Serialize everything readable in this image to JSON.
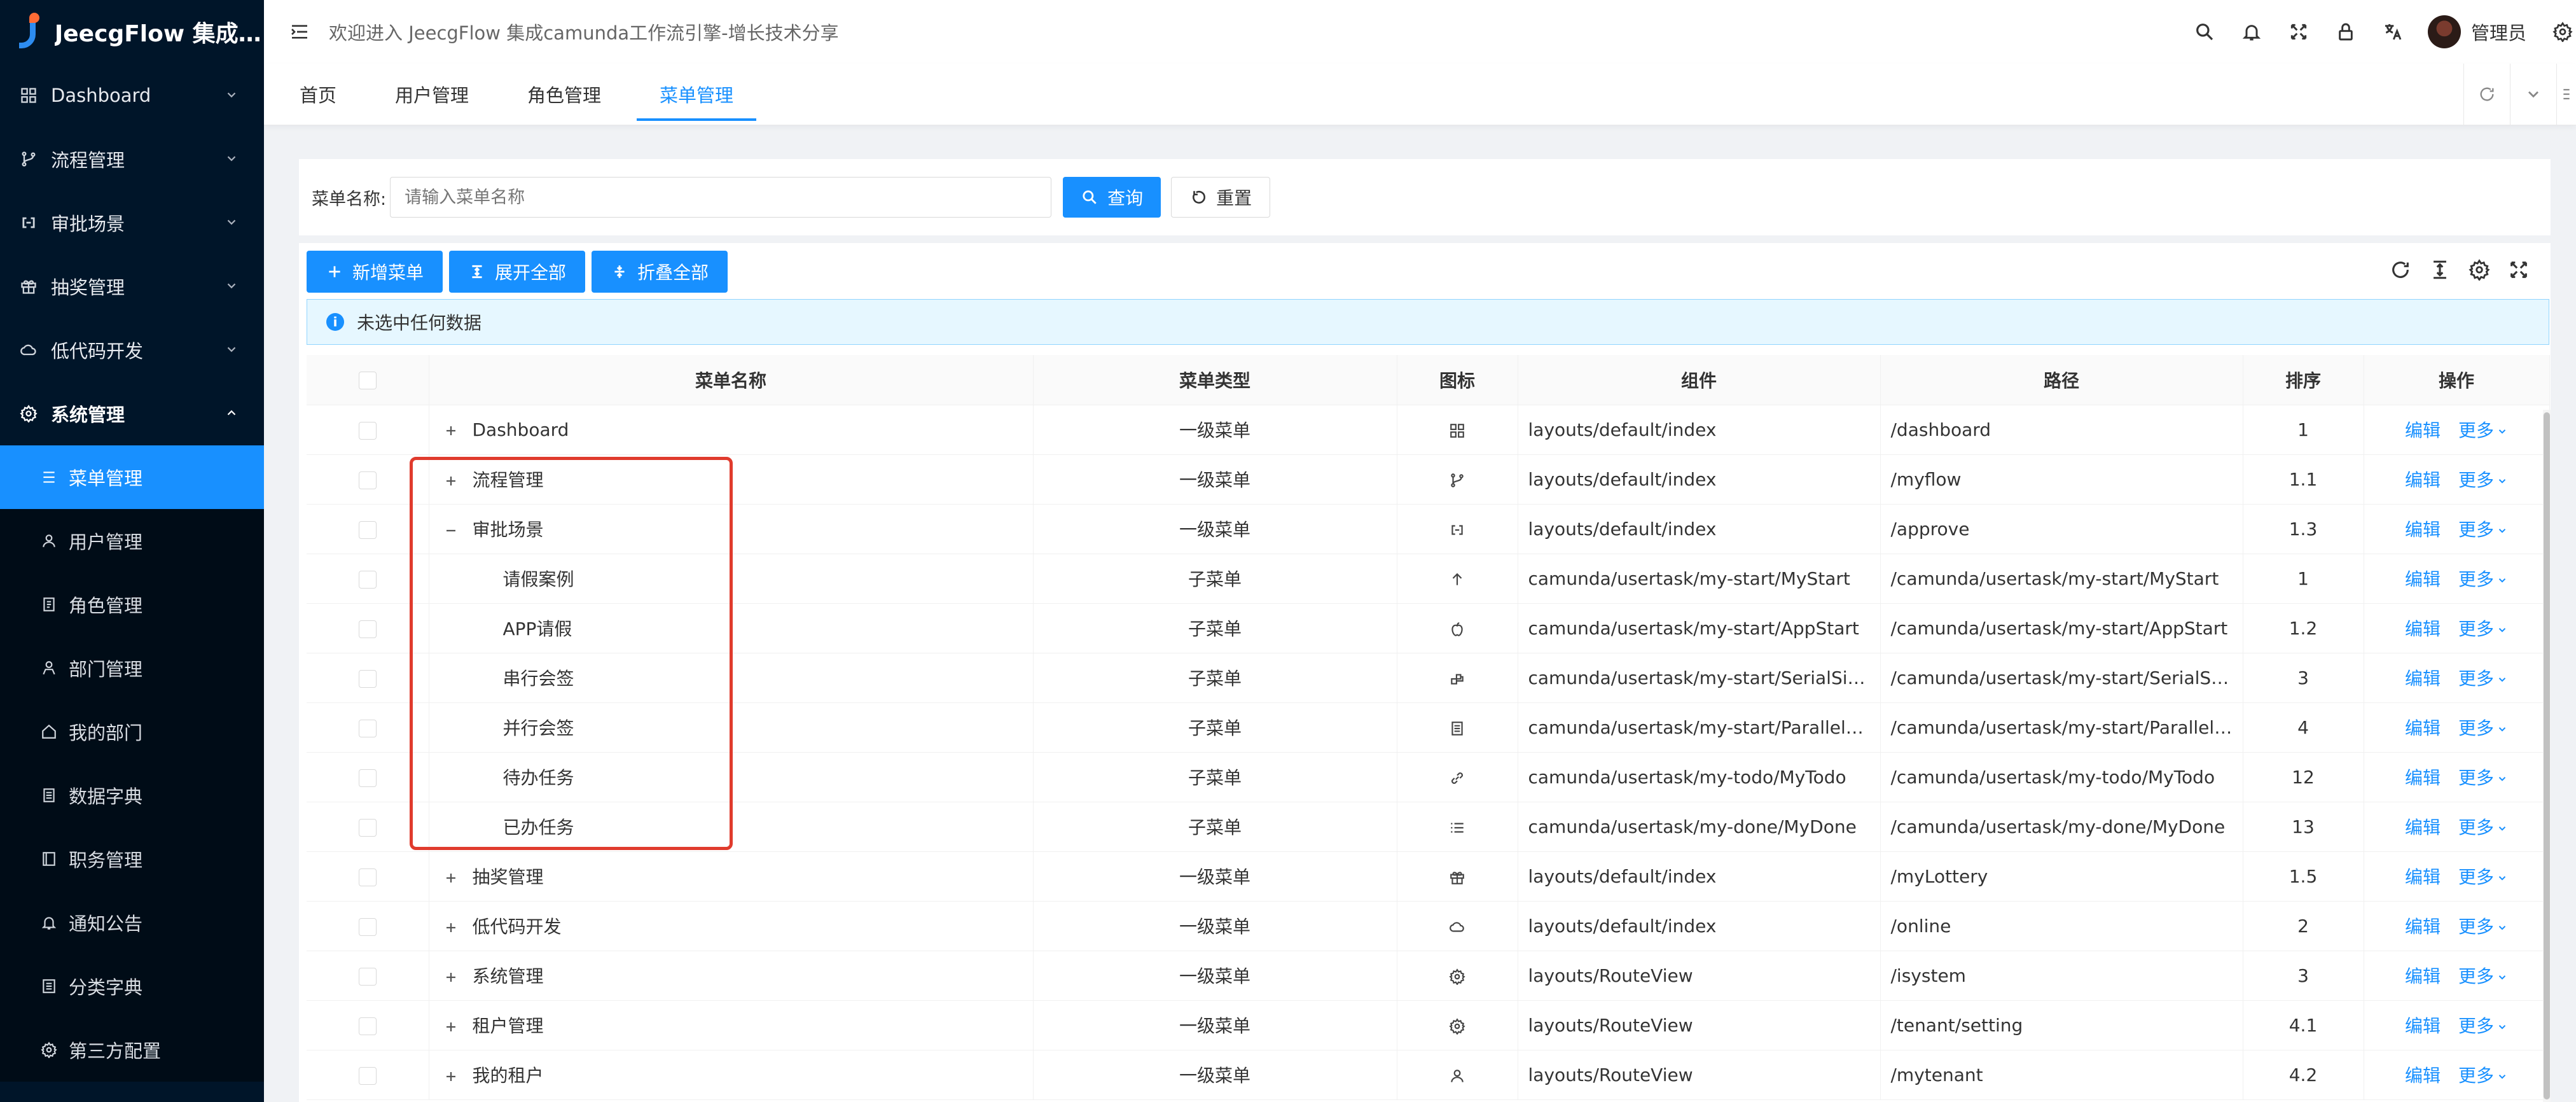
{
  "app": {
    "title": "JeecgFlow 集成camunda工作流"
  },
  "sidebar": {
    "items": [
      {
        "label": "Dashboard",
        "icon": "dashboard-icon"
      },
      {
        "label": "流程管理",
        "icon": "branch-icon"
      },
      {
        "label": "审批场景",
        "icon": "link-icon"
      },
      {
        "label": "抽奖管理",
        "icon": "gift-icon"
      },
      {
        "label": "低代码开发",
        "icon": "cloud-icon"
      },
      {
        "label": "系统管理",
        "icon": "gear-icon"
      }
    ],
    "sub_items": [
      {
        "label": "菜单管理",
        "icon": "menu-list-icon"
      },
      {
        "label": "用户管理",
        "icon": "user-icon"
      },
      {
        "label": "角色管理",
        "icon": "role-icon"
      },
      {
        "label": "部门管理",
        "icon": "department-icon"
      },
      {
        "label": "我的部门",
        "icon": "home-icon"
      },
      {
        "label": "数据字典",
        "icon": "dictionary-icon"
      },
      {
        "label": "职务管理",
        "icon": "position-icon"
      },
      {
        "label": "通知公告",
        "icon": "bell-icon"
      },
      {
        "label": "分类字典",
        "icon": "category-icon"
      },
      {
        "label": "第三方配置",
        "icon": "gear-icon"
      }
    ]
  },
  "header": {
    "welcome": "欢迎进入 JeecgFlow 集成camunda工作流引擎-增长技术分享",
    "user": "管理员"
  },
  "tabs": [
    {
      "label": "首页"
    },
    {
      "label": "用户管理"
    },
    {
      "label": "角色管理"
    },
    {
      "label": "菜单管理",
      "active": true
    }
  ],
  "search": {
    "label": "菜单名称:",
    "placeholder": "请输入菜单名称",
    "query_button": "查询",
    "reset_button": "重置"
  },
  "toolbar": {
    "add": "新增菜单",
    "expand_all": "展开全部",
    "collapse_all": "折叠全部"
  },
  "alert": {
    "text": "未选中任何数据"
  },
  "table": {
    "columns": [
      "菜单名称",
      "菜单类型",
      "图标",
      "组件",
      "路径",
      "排序",
      "操作"
    ],
    "edit_label": "编辑",
    "more_label": "更多",
    "rows": [
      {
        "name": "Dashboard",
        "type": "一级菜单",
        "icon": "dashboard-icon",
        "component": "layouts/default/index",
        "path": "/dashboard",
        "order": "1",
        "expander": "plus",
        "level": 0
      },
      {
        "name": "流程管理",
        "type": "一级菜单",
        "icon": "branch-icon",
        "component": "layouts/default/index",
        "path": "/myflow",
        "order": "1.1",
        "expander": "plus",
        "level": 0
      },
      {
        "name": "审批场景",
        "type": "一级菜单",
        "icon": "link-icon",
        "component": "layouts/default/index",
        "path": "/approve",
        "order": "1.3",
        "expander": "minus",
        "level": 0
      },
      {
        "name": "请假案例",
        "type": "子菜单",
        "icon": "arrow-up-icon",
        "component": "camunda/usertask/my-start/MyStart",
        "path": "/camunda/usertask/my-start/MyStart",
        "order": "1",
        "expander": "none",
        "level": 1
      },
      {
        "name": "APP请假",
        "type": "子菜单",
        "icon": "apple-icon",
        "component": "camunda/usertask/my-start/AppStart",
        "path": "/camunda/usertask/my-start/AppStart",
        "order": "1.2",
        "expander": "none",
        "level": 1
      },
      {
        "name": "串行会签",
        "type": "子菜单",
        "icon": "serial-icon",
        "component": "camunda/usertask/my-start/SerialSignS...",
        "path": "/camunda/usertask/my-start/SerialSign...",
        "order": "3",
        "expander": "none",
        "level": 1
      },
      {
        "name": "并行会签",
        "type": "子菜单",
        "icon": "document-icon",
        "component": "camunda/usertask/my-start/ParallelSig...",
        "path": "/camunda/usertask/my-start/ParallelSig...",
        "order": "4",
        "expander": "none",
        "level": 1
      },
      {
        "name": "待办任务",
        "type": "子菜单",
        "icon": "link-chain-icon",
        "component": "camunda/usertask/my-todo/MyTodo",
        "path": "/camunda/usertask/my-todo/MyTodo",
        "order": "12",
        "expander": "none",
        "level": 1
      },
      {
        "name": "已办任务",
        "type": "子菜单",
        "icon": "list-icon",
        "component": "camunda/usertask/my-done/MyDone",
        "path": "/camunda/usertask/my-done/MyDone",
        "order": "13",
        "expander": "none",
        "level": 1
      },
      {
        "name": "抽奖管理",
        "type": "一级菜单",
        "icon": "gift-icon",
        "component": "layouts/default/index",
        "path": "/myLottery",
        "order": "1.5",
        "expander": "plus",
        "level": 0
      },
      {
        "name": "低代码开发",
        "type": "一级菜单",
        "icon": "cloud-icon",
        "component": "layouts/default/index",
        "path": "/online",
        "order": "2",
        "expander": "plus",
        "level": 0
      },
      {
        "name": "系统管理",
        "type": "一级菜单",
        "icon": "gear-icon",
        "component": "layouts/RouteView",
        "path": "/isystem",
        "order": "3",
        "expander": "plus",
        "level": 0
      },
      {
        "name": "租户管理",
        "type": "一级菜单",
        "icon": "gear-icon",
        "component": "layouts/RouteView",
        "path": "/tenant/setting",
        "order": "4.1",
        "expander": "plus",
        "level": 0
      },
      {
        "name": "我的租户",
        "type": "一级菜单",
        "icon": "user-icon",
        "component": "layouts/RouteView",
        "path": "/mytenant",
        "order": "4.2",
        "expander": "plus",
        "level": 0
      }
    ]
  },
  "colors": {
    "primary": "#1890ff",
    "sidebar": "#001529",
    "annotation": "#e03b2d"
  }
}
